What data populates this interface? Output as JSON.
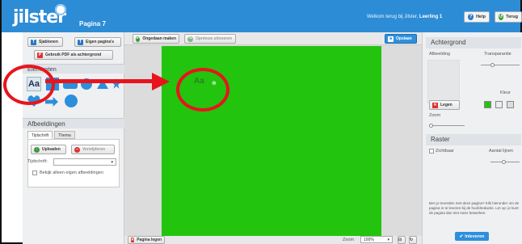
{
  "header": {
    "logo": "jilster",
    "page_label": "Pagina 7",
    "welcome_prefix": "Welkom terug bij Jilster,",
    "welcome_user": "Leerling 1",
    "help_label": "Help",
    "back_label": "Terug"
  },
  "left": {
    "buttons": {
      "sjablonen": "Sjablonen",
      "eigen_paginas": "Eigen pagina's",
      "pdf": "Gebruik PDF als achtergrond"
    },
    "elementen_title": "Elementen",
    "aa_tile": "Aa",
    "afbeeldingen_title": "Afbeeldingen",
    "tabs": [
      "Tijdschrift",
      "Thema"
    ],
    "uploaden_label": "Uploaden",
    "verwijderen_label": "Verwijderen",
    "tijdschrift_label": "Tijdschrift:",
    "eigen_afbeeldingen_label": "Bekijk alleen eigen afbeeldingen"
  },
  "center": {
    "undo_label": "Ongedaan maken",
    "redo_label": "Opnieuw uitvoeren",
    "save_label": "Opslaan",
    "canvas_text": "Aa",
    "canvas_color": "#22c40e",
    "clear_label": "Pagina legen",
    "zoom_label": "Zoom",
    "zoom_value": "100%"
  },
  "right": {
    "achtergrond_title": "Achtergrond",
    "afbeelding_label": "Afbeelding",
    "transparantie_label": "Transparantie",
    "kleur_label": "Kleur",
    "legen_label": "Legen",
    "zoom_label": "Zoom",
    "raster_title": "Raster",
    "zichtbaar_label": "Zichtbaar",
    "aantal_lijnen_label": "Aantal lijnen",
    "help_text": "Ben je tevreden met deze pagina? Klik hieronder om de pagina in te leveren bij de hoofdredactie. Let op: je kunt de pagina dan niet meer bewerken.",
    "inleveren_label": "Inleveren",
    "swatch_color": "#22c40e"
  }
}
